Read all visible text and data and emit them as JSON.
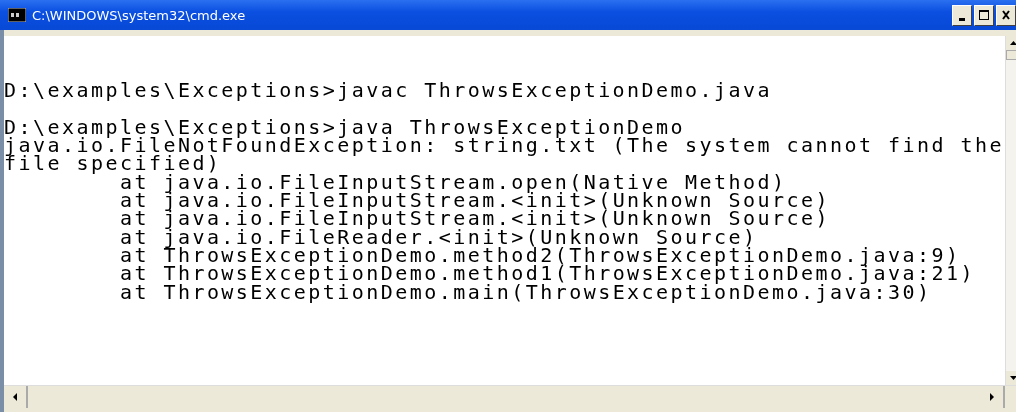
{
  "window": {
    "title": "C:\\WINDOWS\\system32\\cmd.exe"
  },
  "console_lines": [
    {
      "kind": "command",
      "text": "D:\\examples\\Exceptions>javac ThrowsExceptionDemo.java"
    },
    {
      "kind": "command",
      "text": "D:\\examples\\Exceptions>java ThrowsExceptionDemo"
    },
    {
      "kind": "output",
      "text": "java.io.FileNotFoundException: string.txt (The system cannot find the"
    },
    {
      "kind": "output",
      "text": "file specified)"
    },
    {
      "kind": "output",
      "text": "\tat java.io.FileInputStream.open(Native Method)"
    },
    {
      "kind": "output",
      "text": "\tat java.io.FileInputStream.<init>(Unknown Source)"
    },
    {
      "kind": "output",
      "text": "\tat java.io.FileInputStream.<init>(Unknown Source)"
    },
    {
      "kind": "output",
      "text": "\tat java.io.FileReader.<init>(Unknown Source)"
    },
    {
      "kind": "output",
      "text": "\tat ThrowsExceptionDemo.method2(ThrowsExceptionDemo.java:9)"
    },
    {
      "kind": "output",
      "text": "\tat ThrowsExceptionDemo.method1(ThrowsExceptionDemo.java:21)"
    },
    {
      "kind": "output",
      "text": "\tat ThrowsExceptionDemo.main(ThrowsExceptionDemo.java:30)"
    }
  ]
}
